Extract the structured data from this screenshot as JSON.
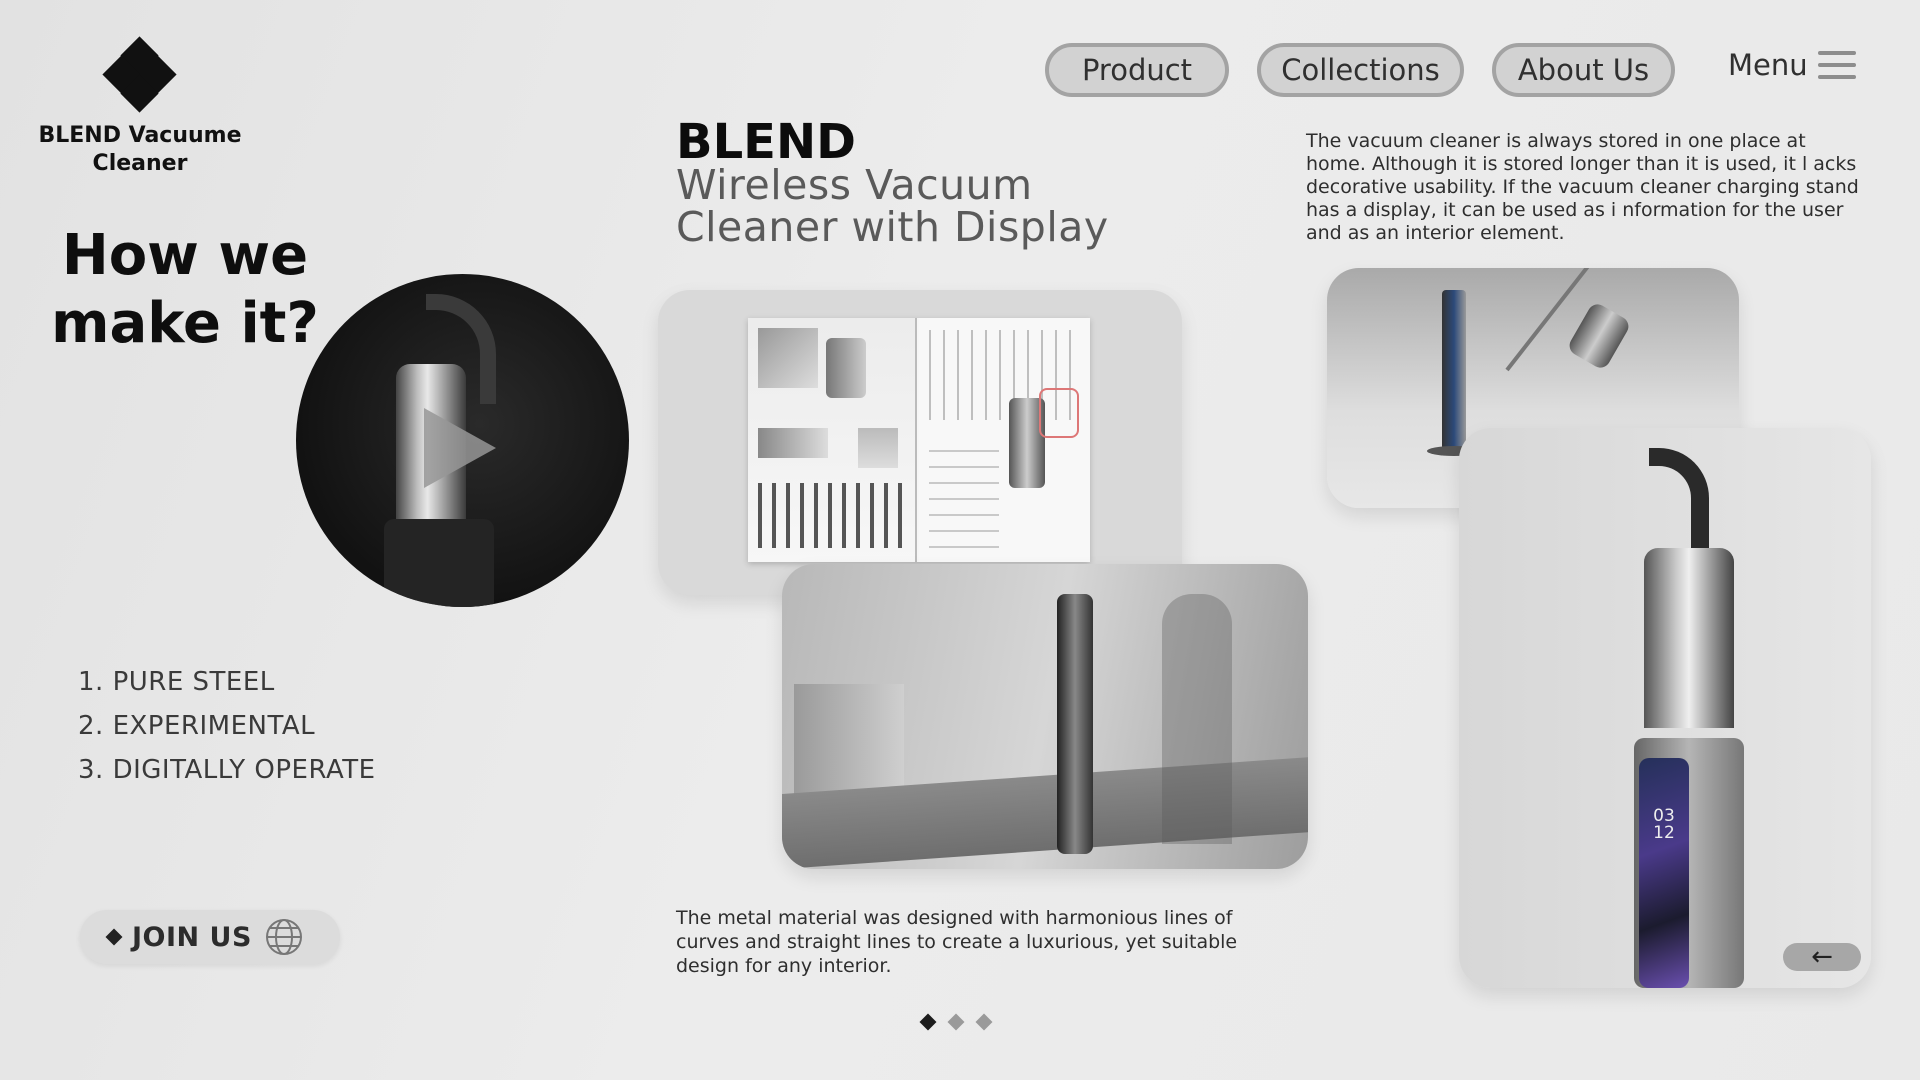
{
  "brand": {
    "name": "BLEND Vacuume Cleaner",
    "logo_icon": "diamond-cluster-icon"
  },
  "nav": {
    "items": [
      {
        "label": "Product"
      },
      {
        "label": "Collections"
      },
      {
        "label": "About Us"
      }
    ],
    "menu_label": "Menu",
    "menu_icon": "hamburger-icon"
  },
  "hero": {
    "heading": "How we make it?",
    "title": "BLEND",
    "subtitle_line1": "Wireless Vacuum",
    "subtitle_line2": "Cleaner with Display",
    "description_top": "The vacuum cleaner is always stored in one place at home. Although it is stored longer than it is used, it l acks decorative usability. If the vacuum cleaner charging stand has a display, it can be used as i nformation for the user and as an interior element.",
    "description_bottom": "The metal material was designed with harmonious lines of curves and straight lines to create a luxurious, yet suitable design for any interior."
  },
  "features": [
    {
      "label": "1. PURE STEEL"
    },
    {
      "label": "2. EXPERIMENTAL"
    },
    {
      "label": "3. DIGITALLY OPERATE"
    }
  ],
  "cta": {
    "label": "JOIN US",
    "icon": "globe-icon"
  },
  "display_readout": {
    "line1": "03",
    "line2": "12"
  },
  "carousel": {
    "total": 3,
    "active": 1
  },
  "colors": {
    "background": "#e8e8e8",
    "accent": "#111111",
    "pill": "#d2d2d2"
  }
}
